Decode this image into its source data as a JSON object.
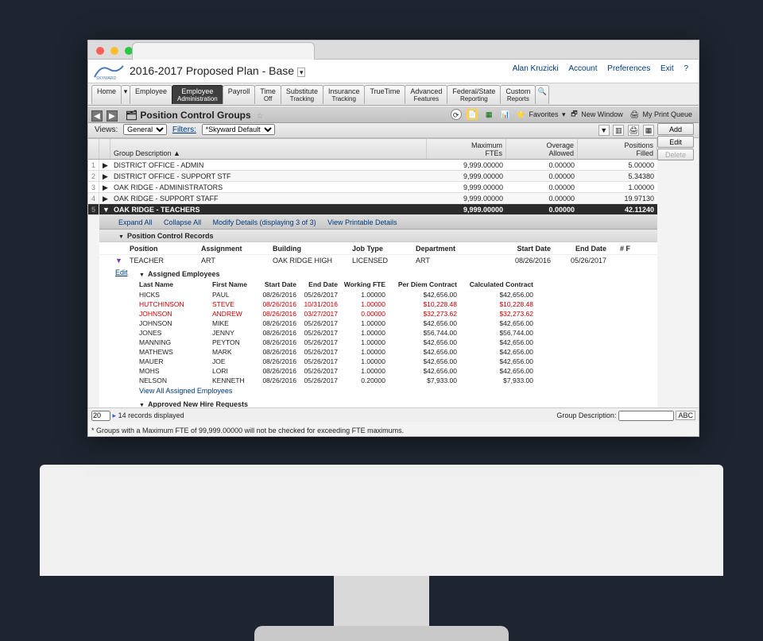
{
  "header": {
    "plan_title": "2016-2017 Proposed Plan - Base",
    "top_links": [
      "Alan Kruzicki",
      "Account",
      "Preferences",
      "Exit",
      "?"
    ]
  },
  "nav_tabs": [
    {
      "label": "Home"
    },
    {
      "label": "Employee"
    },
    {
      "label": "Employee",
      "sub": "Administration",
      "active": true
    },
    {
      "label": "Payroll"
    },
    {
      "label": "Time",
      "sub": "Off"
    },
    {
      "label": "Substitute",
      "sub": "Tracking"
    },
    {
      "label": "Insurance",
      "sub": "Tracking"
    },
    {
      "label": "TrueTime"
    },
    {
      "label": "Advanced",
      "sub": "Features"
    },
    {
      "label": "Federal/State",
      "sub": "Reporting"
    },
    {
      "label": "Custom",
      "sub": "Reports"
    }
  ],
  "page_bar": {
    "title": "Position Control Groups",
    "favorites": "Favorites",
    "new_window": "New Window",
    "print_queue": "My Print Queue"
  },
  "filter_row": {
    "views_label": "Views:",
    "views_value": "General",
    "filters_label": "Filters:",
    "filters_value": "*Skyward Default"
  },
  "action_buttons": {
    "add": "Add",
    "edit": "Edit",
    "delete": "Delete"
  },
  "grid": {
    "columns": {
      "desc": "Group Description ▲",
      "max_fte_1": "Maximum",
      "max_fte_2": "FTEs",
      "overage_1": "Overage",
      "overage_2": "Allowed",
      "positions_1": "Positions",
      "positions_2": "Filled"
    },
    "rows": [
      {
        "n": "1",
        "desc": "DISTRICT OFFICE - ADMIN",
        "fte": "9,999.00000",
        "ova": "0.00000",
        "pos": "5.00000"
      },
      {
        "n": "2",
        "desc": "DISTRICT OFFICE - SUPPORT STF",
        "fte": "9,999.00000",
        "ova": "0.00000",
        "pos": "5.34380"
      },
      {
        "n": "3",
        "desc": "OAK RIDGE - ADMINISTRATORS",
        "fte": "9,999.00000",
        "ova": "0.00000",
        "pos": "1.00000"
      },
      {
        "n": "4",
        "desc": "OAK RIDGE - SUPPORT STAFF",
        "fte": "9,999.00000",
        "ova": "0.00000",
        "pos": "19.97130"
      },
      {
        "n": "5",
        "desc": "OAK RIDGE - TEACHERS",
        "fte": "9,999.00000",
        "ova": "0.00000",
        "pos": "42.11240",
        "sel": true
      }
    ]
  },
  "detail_toolbar": {
    "expand": "Expand All",
    "collapse": "Collapse All",
    "modify": "Modify Details (displaying 3 of 3)",
    "printable": "View Printable Details"
  },
  "pcr": {
    "section_title": "Position Control Records",
    "cols": {
      "pos": "Position",
      "asn": "Assignment",
      "bld": "Building",
      "jt": "Job Type",
      "dept": "Department",
      "sd": "Start Date",
      "ed": "End Date",
      "nf": "# F"
    },
    "row": {
      "edit": "Edit",
      "pos": "TEACHER",
      "asn": "ART",
      "bld": "OAK RIDGE HIGH",
      "jt": "LICENSED",
      "dept": "ART",
      "sd": "08/26/2016",
      "ed": "05/26/2017"
    }
  },
  "ae": {
    "title": "Assigned Employees",
    "cols": {
      "ln": "Last Name",
      "fn": "First Name",
      "sd": "Start Date",
      "ed": "End Date",
      "wfte": "Working FTE",
      "pdc": "Per Diem Contract",
      "cc": "Calculated Contract"
    },
    "rows": [
      {
        "ln": "HICKS",
        "fn": "PAUL",
        "sd": "08/26/2016",
        "ed": "05/26/2017",
        "wfte": "1.00000",
        "pdc": "$42,656.00",
        "cc": "$42,656.00"
      },
      {
        "ln": "HUTCHINSON",
        "fn": "STEVE",
        "sd": "08/26/2016",
        "ed": "10/31/2016",
        "wfte": "1.00000",
        "pdc": "$10,228.48",
        "cc": "$10,228.48",
        "red": true
      },
      {
        "ln": "JOHNSON",
        "fn": "ANDREW",
        "sd": "08/26/2016",
        "ed": "03/27/2017",
        "wfte": "0.00000",
        "pdc": "$32,273.62",
        "cc": "$32,273.62",
        "red": true
      },
      {
        "ln": "JOHNSON",
        "fn": "MIKE",
        "sd": "08/26/2016",
        "ed": "05/26/2017",
        "wfte": "1.00000",
        "pdc": "$42,656.00",
        "cc": "$42,656.00"
      },
      {
        "ln": "JONES",
        "fn": "JENNY",
        "sd": "08/26/2016",
        "ed": "05/26/2017",
        "wfte": "1.00000",
        "pdc": "$56,744.00",
        "cc": "$56,744.00"
      },
      {
        "ln": "MANNING",
        "fn": "PEYTON",
        "sd": "08/26/2016",
        "ed": "05/26/2017",
        "wfte": "1.00000",
        "pdc": "$42,656.00",
        "cc": "$42,656.00"
      },
      {
        "ln": "MATHEWS",
        "fn": "MARK",
        "sd": "08/26/2016",
        "ed": "05/26/2017",
        "wfte": "1.00000",
        "pdc": "$42,656.00",
        "cc": "$42,656.00"
      },
      {
        "ln": "MAUER",
        "fn": "JOE",
        "sd": "08/26/2016",
        "ed": "05/26/2017",
        "wfte": "1.00000",
        "pdc": "$42,656.00",
        "cc": "$42,656.00"
      },
      {
        "ln": "MOHS",
        "fn": "LORI",
        "sd": "08/26/2016",
        "ed": "05/26/2017",
        "wfte": "1.00000",
        "pdc": "$42,656.00",
        "cc": "$42,656.00"
      },
      {
        "ln": "NELSON",
        "fn": "KENNETH",
        "sd": "08/26/2016",
        "ed": "05/26/2017",
        "wfte": "0.20000",
        "pdc": "$7,933.00",
        "cc": "$7,933.00"
      }
    ],
    "view_all": "View All Assigned Employees"
  },
  "approved_title": "Approved New Hire Requests",
  "footer": {
    "page_size": "20",
    "records": "14 records displayed",
    "gd_label": "Group Description:",
    "abc": "ABC"
  },
  "footnote": "* Groups with a Maximum FTE of 99,999.00000 will not be checked for exceeding FTE maximums."
}
